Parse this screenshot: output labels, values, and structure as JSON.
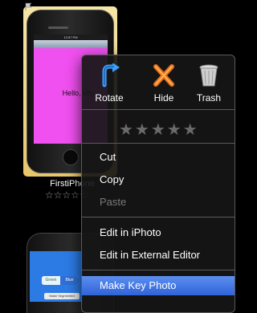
{
  "thumbnails": [
    {
      "screen_text": "Hello, Wo",
      "status_time": "12:57 PM",
      "filename": "FirstiPhone",
      "rating_stars": "☆☆☆☆☆",
      "selected": true
    },
    {
      "segment_left": "Green",
      "segment_right": "Blue",
      "status_text": "Make Segmented"
    }
  ],
  "context_menu": {
    "toolbar": [
      {
        "label": "Rotate",
        "icon": "rotate-icon"
      },
      {
        "label": "Hide",
        "icon": "hide-icon"
      },
      {
        "label": "Trash",
        "icon": "trash-icon"
      }
    ],
    "rating": "★★★★★",
    "items": [
      {
        "label": "Cut",
        "enabled": true
      },
      {
        "label": "Copy",
        "enabled": true
      },
      {
        "label": "Paste",
        "enabled": false
      },
      {
        "label": "Edit in iPhoto",
        "enabled": true
      },
      {
        "label": "Edit in External Editor",
        "enabled": true
      },
      {
        "label": "Make Key Photo",
        "enabled": true,
        "highlighted": true
      }
    ]
  },
  "colors": {
    "selection": "#f0d27a",
    "screen_background": "#f050f0",
    "highlight": "#3a6fe0",
    "menu_background": "#161616"
  }
}
